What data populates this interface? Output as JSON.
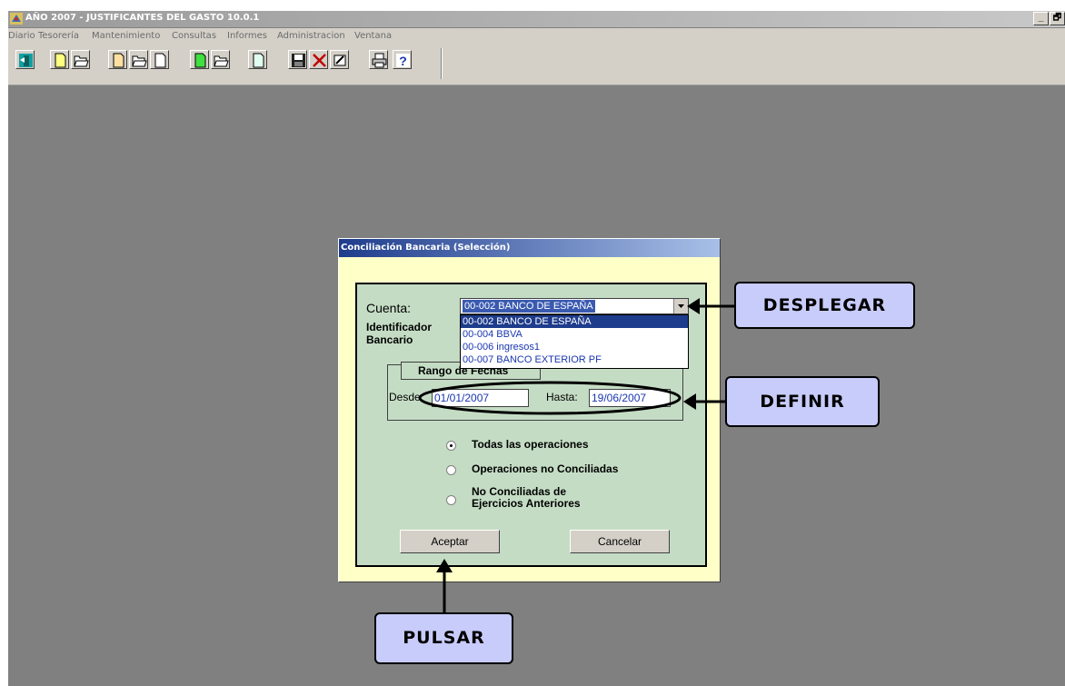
{
  "window": {
    "title": "AÑO 2007 - JUSTIFICANTES DEL GASTO 10.0.1",
    "controls": [
      "_",
      "🗗",
      "✕"
    ]
  },
  "menu": [
    "Diario",
    "Tesorería",
    "Mantenimiento",
    "Consultas",
    "Informes",
    "Administracion",
    "Ventana"
  ],
  "toolbar": {
    "icons": [
      "exit-icon",
      "new-document-icon",
      "open-folder-icon",
      "new-document-icon",
      "open-folder-icon",
      "document-icon",
      "new-green-document-icon",
      "open-folder-icon",
      "document-icon",
      "save-icon",
      "delete-icon",
      "edit-icon",
      "print-icon",
      "help-icon"
    ]
  },
  "dialog": {
    "title": "Conciliación Bancaria (Selección)",
    "cuenta_label": "Cuenta:",
    "cuenta_value": "00-002 BANCO DE ESPAÑA",
    "cuenta_options": [
      "00-002 BANCO DE ESPAÑA",
      "00-004 BBVA",
      "00-006 ingresos1",
      "00-007 BANCO EXTERIOR PF"
    ],
    "identificador_label_1": "Identificador",
    "identificador_label_2": "Bancario",
    "rango_label": "Rango de Fechas",
    "desde_label": "Desde:",
    "desde_value": "01/01/2007",
    "hasta_label": "Hasta:",
    "hasta_value": "19/06/2007",
    "radio_todas": "Todas las operaciones",
    "radio_no_conciliadas": "Operaciones no Conciliadas",
    "radio_ejercicios_1": "No Conciliadas de",
    "radio_ejercicios_2": "Ejercicios Anteriores",
    "selected_option": "Todas las operaciones",
    "aceptar": "Aceptar",
    "cancelar": "Cancelar"
  },
  "annotations": {
    "desplegar": "DESPLEGAR",
    "definir": "DEFINIR",
    "pulsar": "PULSAR"
  }
}
